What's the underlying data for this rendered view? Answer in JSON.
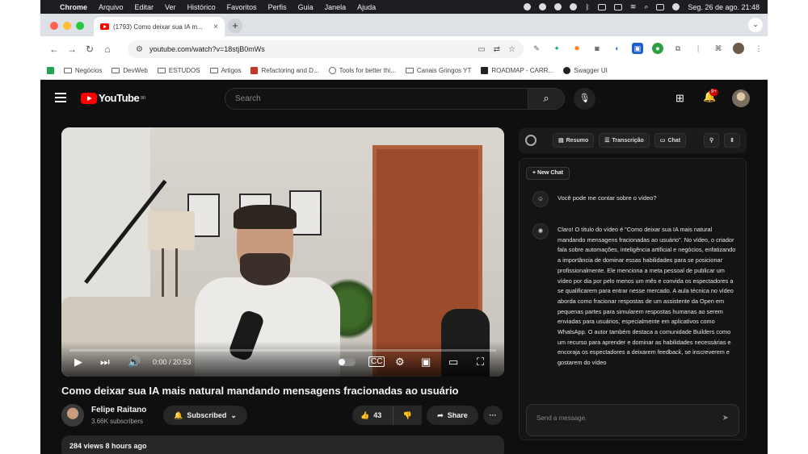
{
  "menubar": {
    "app_name": "Chrome",
    "menus": [
      "Arquivo",
      "Editar",
      "Ver",
      "Histórico",
      "Favoritos",
      "Perfis",
      "Guia",
      "Janela",
      "Ajuda"
    ],
    "datetime": "Seg. 26 de ago.  21:48"
  },
  "tab": {
    "title": "(1793) Como deixar sua IA m...",
    "close": "×",
    "new_tab": "+",
    "menu": "⌄"
  },
  "toolbar": {
    "url": "youtube.com/watch?v=18stjB0mWs"
  },
  "bookmarks": [
    "Negócios",
    "DevWeb",
    "ESTUDOS",
    "Artigos",
    "Refactoring and D...",
    "Tools for better thi...",
    "Canais Gringos YT",
    "ROADMAP - CARR...",
    "Swagger UI"
  ],
  "youtube": {
    "logo_text": "YouTube",
    "logo_region": "BR",
    "search_placeholder": "Search",
    "notification_count": "9+"
  },
  "video": {
    "current_time": "0:00 / 20:53",
    "progress_fraction": 0.0,
    "title": "Como deixar sua IA mais natural mandando mensagens fracionadas ao usuário",
    "channel_name": "Felipe Raitano",
    "subscribers": "3.66K subscribers",
    "subscribe_label": "Subscribed",
    "likes": "43",
    "share_label": "Share",
    "more_label": "···",
    "views_line": "284 views  8 hours ago"
  },
  "sidebar": {
    "tabs": [
      "Resumo",
      "Transcrição",
      "Chat"
    ],
    "new_chat": "+ New Chat",
    "user_message": "Você pode me contar sobre o vídeo?",
    "ai_message": "Claro! O título do vídeo é \"Como deixar sua IA mais natural mandando mensagens fracionadas ao usuário\". No vídeo, o criador fala sobre automações, inteligência artificial e negócios, enfatizando a importância de dominar essas habilidades para se posicionar profissionalmente. Ele menciona a meta pessoal de publicar um vídeo por dia por pelo menos um mês e convida os espectadores a se qualificarem para entrar nesse mercado. A aula técnica no vídeo aborda como fracionar respostas de um assistente da Open em pequenas partes para simularem respostas humanas ao serem enviadas para usuários, especialmente em aplicativos como WhatsApp. O autor também destaca a comunidade Builders como um recurso para aprender e dominar as habilidades necessárias e encoraja os espectadores a deixarem feedback, se inscreverem e gostarem do vídeo",
    "input_placeholder": "Send a message."
  },
  "colors": {
    "yt_red": "#ff0000",
    "yt_bg": "#0f0f0f",
    "pill_bg": "#272727"
  }
}
